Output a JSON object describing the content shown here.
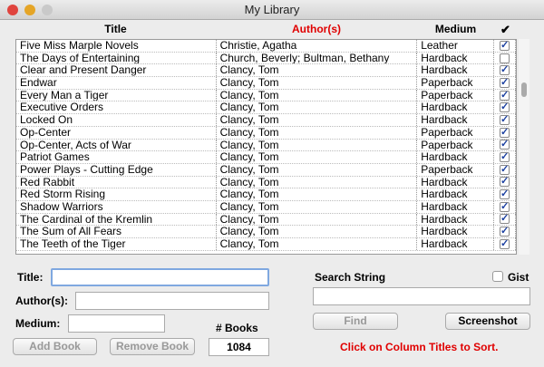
{
  "window": {
    "title": "My Library"
  },
  "columns": {
    "title": "Title",
    "author": "Author(s)",
    "medium": "Medium",
    "check": "✔"
  },
  "rows": [
    {
      "title": "Five Miss Marple Novels",
      "author": "Christie, Agatha",
      "medium": "Leather",
      "checked": true
    },
    {
      "title": "The Days of Entertaining",
      "author": "Church, Beverly; Bultman, Bethany",
      "medium": "Hardback",
      "checked": false
    },
    {
      "title": "Clear and Present Danger",
      "author": "Clancy, Tom",
      "medium": "Hardback",
      "checked": true
    },
    {
      "title": "Endwar",
      "author": "Clancy, Tom",
      "medium": "Paperback",
      "checked": true
    },
    {
      "title": "Every Man a Tiger",
      "author": "Clancy, Tom",
      "medium": "Paperback",
      "checked": true
    },
    {
      "title": "Executive Orders",
      "author": "Clancy, Tom",
      "medium": "Hardback",
      "checked": true
    },
    {
      "title": "Locked On",
      "author": "Clancy, Tom",
      "medium": "Hardback",
      "checked": true
    },
    {
      "title": "Op-Center",
      "author": "Clancy, Tom",
      "medium": "Paperback",
      "checked": true
    },
    {
      "title": "Op-Center, Acts of War",
      "author": "Clancy, Tom",
      "medium": "Paperback",
      "checked": true
    },
    {
      "title": "Patriot Games",
      "author": "Clancy, Tom",
      "medium": "Hardback",
      "checked": true
    },
    {
      "title": "Power Plays - Cutting Edge",
      "author": "Clancy, Tom",
      "medium": "Paperback",
      "checked": true
    },
    {
      "title": "Red Rabbit",
      "author": "Clancy, Tom",
      "medium": "Hardback",
      "checked": true
    },
    {
      "title": "Red Storm Rising",
      "author": "Clancy, Tom",
      "medium": "Hardback",
      "checked": true
    },
    {
      "title": "Shadow Warriors",
      "author": "Clancy, Tom",
      "medium": "Hardback",
      "checked": true
    },
    {
      "title": "The Cardinal of the Kremlin",
      "author": "Clancy, Tom",
      "medium": "Hardback",
      "checked": true
    },
    {
      "title": "The Sum of All Fears",
      "author": "Clancy, Tom",
      "medium": "Hardback",
      "checked": true
    },
    {
      "title": "The Teeth of the Tiger",
      "author": "Clancy, Tom",
      "medium": "Hardback",
      "checked": true
    }
  ],
  "form": {
    "title_label": "Title:",
    "title_value": "",
    "author_label": "Author(s):",
    "author_value": "",
    "medium_label": "Medium:",
    "medium_value": "",
    "books_label": "# Books",
    "books_count": "1084",
    "add": "Add Book",
    "remove": "Remove Book"
  },
  "search": {
    "label": "Search String",
    "value": "",
    "gist_label": "Gist",
    "gist_checked": false,
    "find": "Find",
    "screenshot": "Screenshot",
    "hint": "Click on Column Titles to Sort."
  },
  "colors": {
    "accent_red": "#e00000"
  }
}
